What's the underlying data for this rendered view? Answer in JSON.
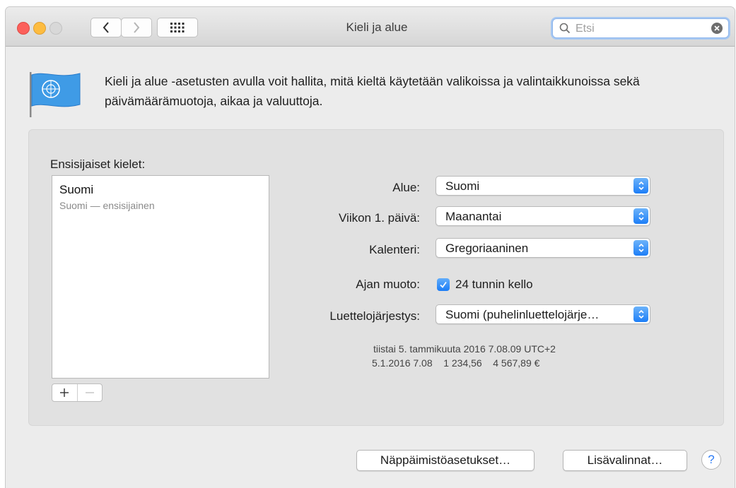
{
  "window": {
    "title": "Kieli ja alue"
  },
  "search": {
    "placeholder": "Etsi",
    "value": ""
  },
  "header": {
    "description": "Kieli ja alue -asetusten avulla voit hallita, mitä kieltä käytetään valikoissa ja valintaikkunoissa sekä päivämäärämuotoja, aikaa ja valuuttoja."
  },
  "languages": {
    "label": "Ensisijaiset kielet:",
    "items": [
      {
        "name": "Suomi",
        "subtitle": "Suomi — ensisijainen"
      }
    ],
    "add_label": "+",
    "remove_label": "−"
  },
  "settings": {
    "region": {
      "label": "Alue:",
      "value": "Suomi"
    },
    "first_day": {
      "label": "Viikon 1. päivä:",
      "value": "Maanantai"
    },
    "calendar": {
      "label": "Kalenteri:",
      "value": "Gregoriaaninen"
    },
    "time_format": {
      "label": "Ajan muoto:",
      "checkbox_label": "24 tunnin kello",
      "checked": true
    },
    "list_sort": {
      "label": "Luettelojärjestys:",
      "value": "Suomi (puhelinluettelojärje…"
    }
  },
  "sample": {
    "line1": "tiistai 5. tammikuuta 2016 7.08.09 UTC+2",
    "line2": "5.1.2016 7.08    1 234,56    4 567,89 €"
  },
  "buttons": {
    "keyboard": "Näppäimistöasetukset…",
    "advanced": "Lisävalinnat…",
    "help": "?"
  },
  "colors": {
    "accent": "#1d7ef7",
    "close": "#fc605b",
    "minimize": "#fdbc40"
  }
}
